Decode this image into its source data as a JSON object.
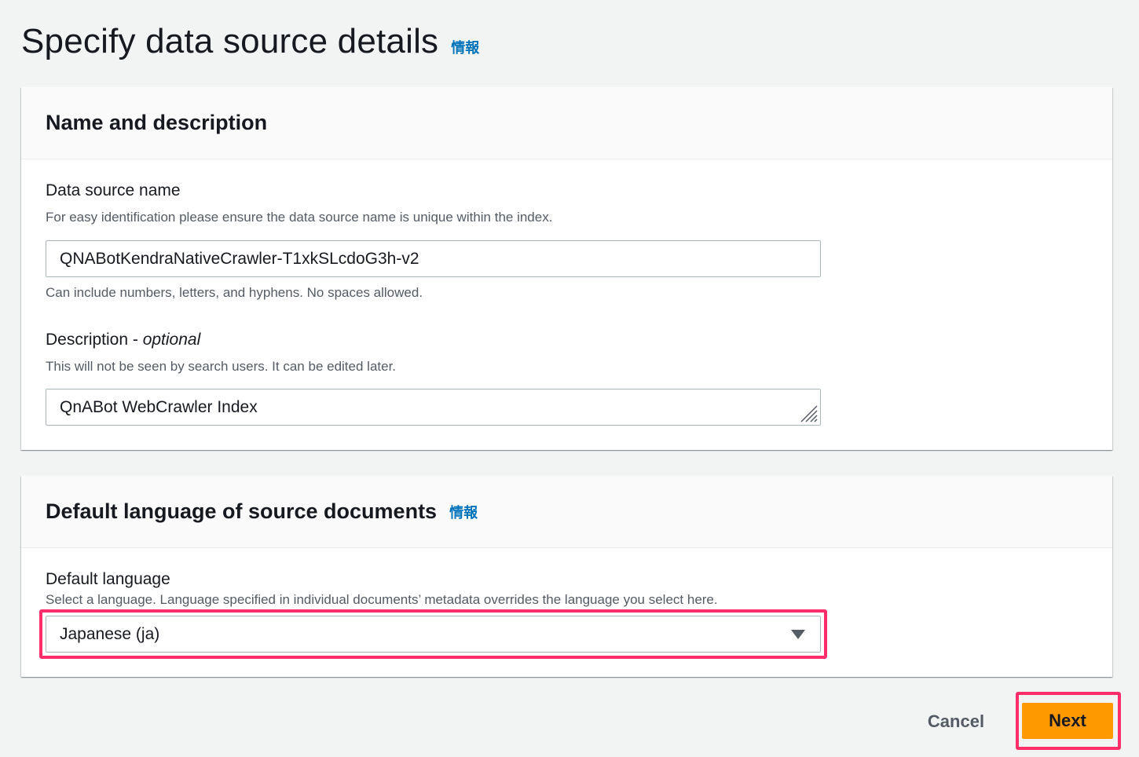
{
  "page": {
    "title": "Specify data source details",
    "info_link": "情報"
  },
  "name_panel": {
    "title": "Name and description",
    "data_source_name": {
      "label": "Data source name",
      "description": "For easy identification please ensure the data source name is unique within the index.",
      "value": "QNABotKendraNativeCrawler-T1xkSLcdoG3h-v2",
      "constraint": "Can include numbers, letters, and hyphens. No spaces allowed."
    },
    "description_field": {
      "label": "Description - ",
      "label_optional": "optional",
      "description": "This will not be seen by search users. It can be edited later.",
      "value": "QnABot WebCrawler Index"
    }
  },
  "language_panel": {
    "title": "Default language of source documents",
    "info_link": "情報",
    "default_language": {
      "label": "Default language",
      "description": "Select a language. Language specified in individual documents’ metadata overrides the language you select here.",
      "selected": "Japanese (ja)"
    }
  },
  "actions": {
    "cancel_label": "Cancel",
    "next_label": "Next"
  },
  "colors": {
    "accent": "#ff9900",
    "link": "#0073bb",
    "highlight": "#ff2e6a"
  }
}
